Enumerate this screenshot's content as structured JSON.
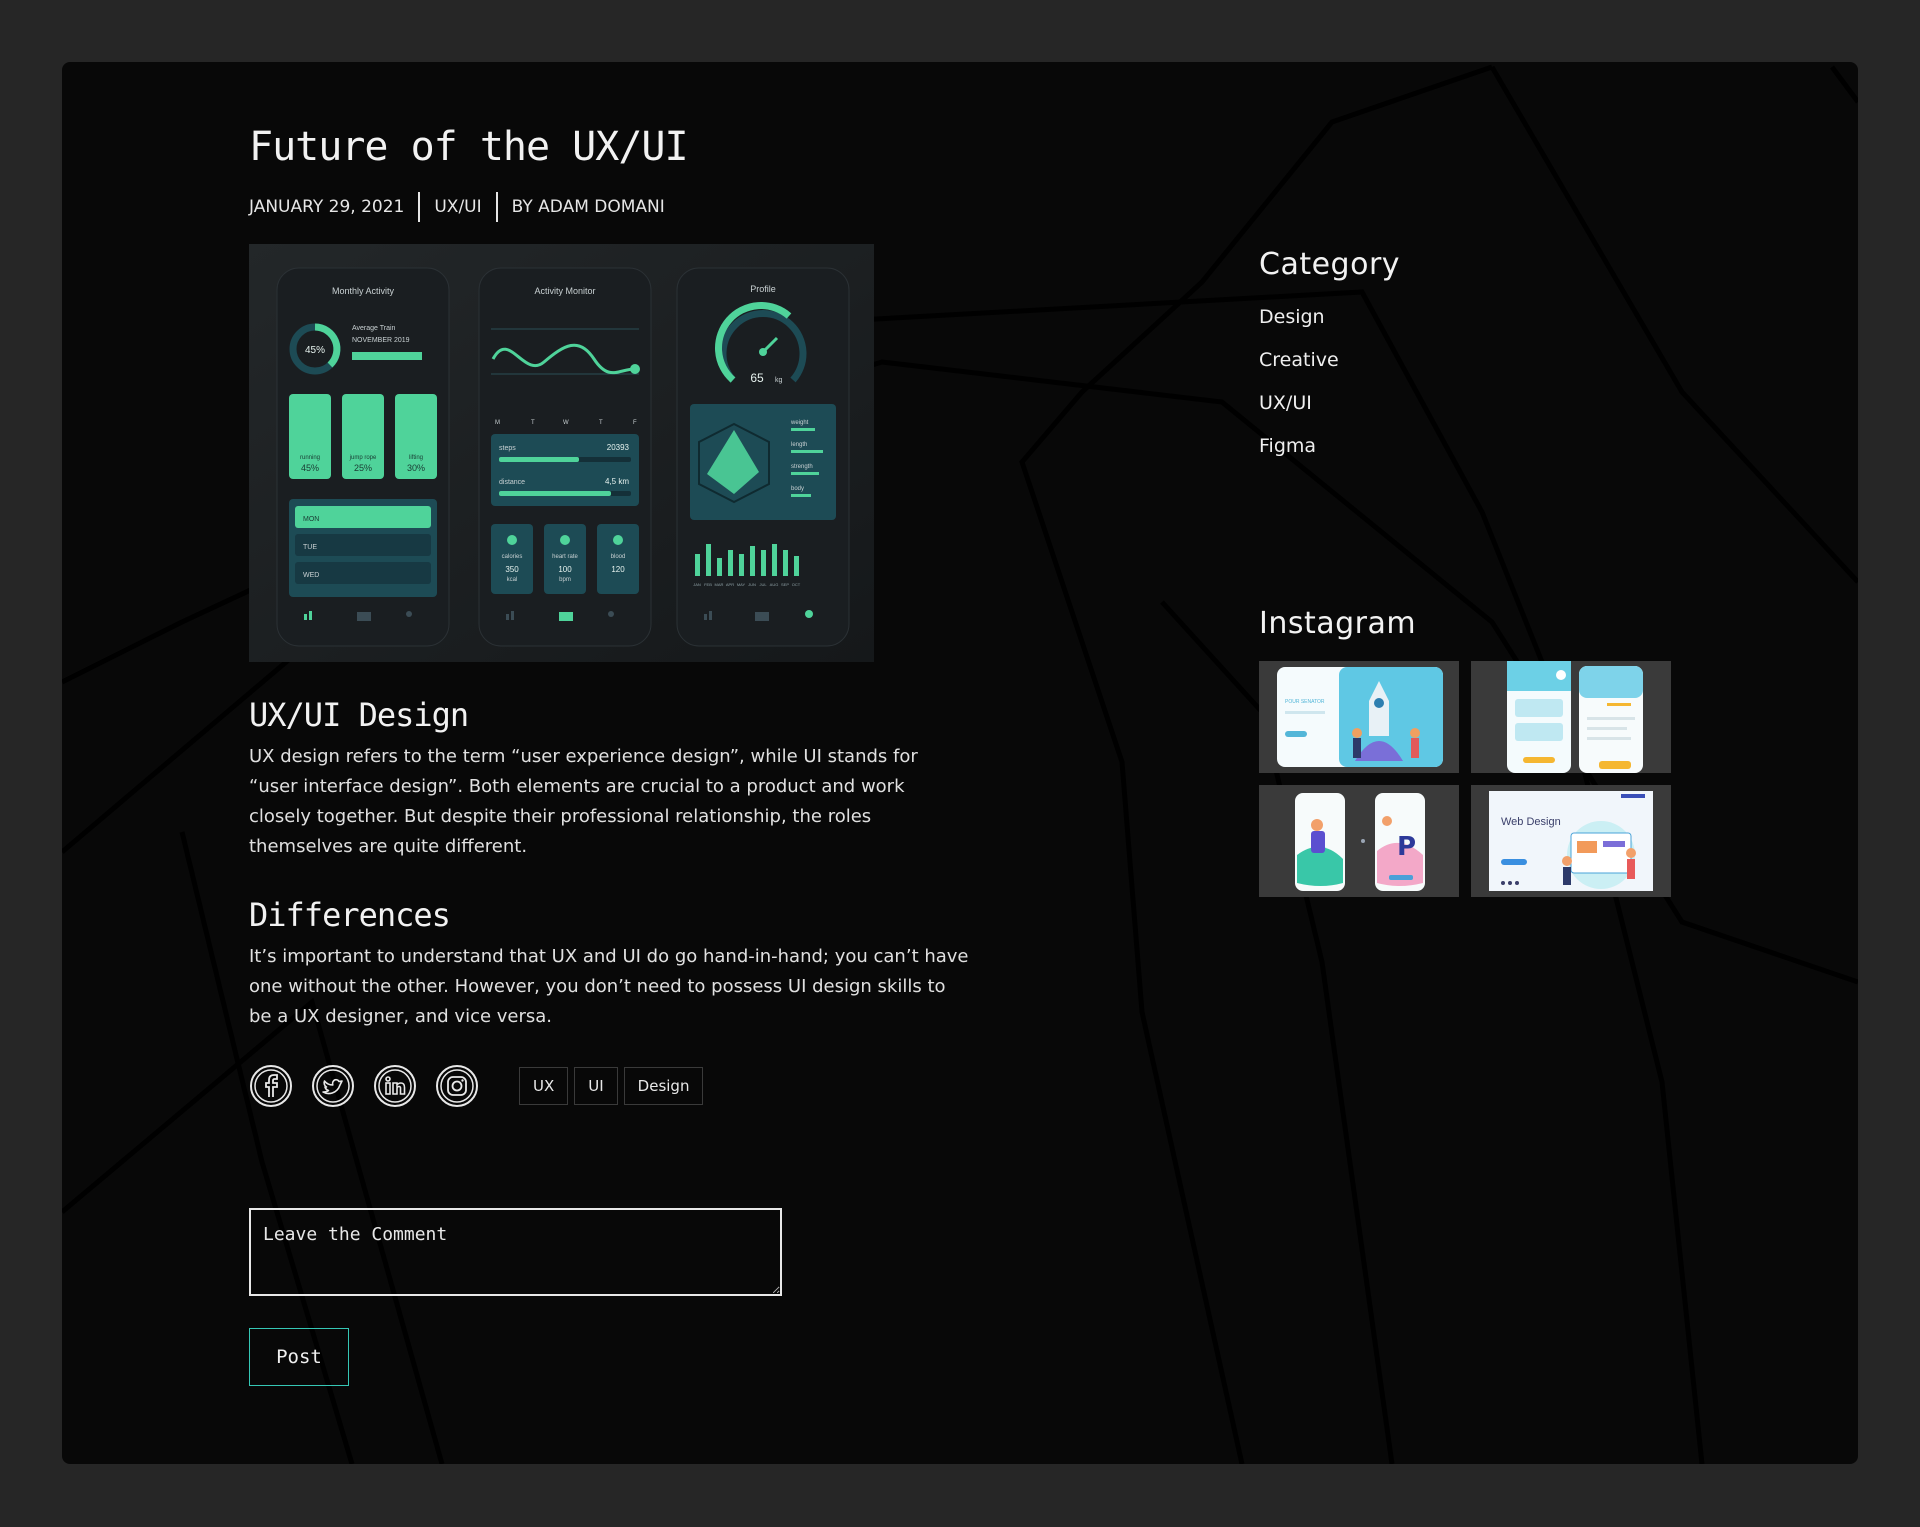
{
  "post": {
    "title": "Future of the UX/UI",
    "date": "JANUARY 29, 2021",
    "category": "UX/UI",
    "author": "BY ADAM DOMANI",
    "hero_image": {
      "screens": [
        {
          "title": "Monthly Activity",
          "ring_value": "45%",
          "subtitle_1": "Average Train",
          "subtitle_2": "NOVEMBER 2019",
          "tiles": [
            {
              "label": "running",
              "value": "45%"
            },
            {
              "label": "jump rope",
              "value": "25%"
            },
            {
              "label": "lifting",
              "value": "30%"
            }
          ],
          "days": [
            "MON",
            "TUE",
            "WED"
          ]
        },
        {
          "title": "Activity Monitor",
          "days": [
            "M",
            "T",
            "W",
            "T",
            "F"
          ],
          "steps_label": "steps",
          "steps_value": "20393",
          "distance_label": "distance",
          "distance_value": "4,5 km",
          "stats": [
            {
              "label": "calories",
              "value": "350",
              "unit": "kcal"
            },
            {
              "label": "heart rate",
              "value": "100",
              "unit": "bpm"
            },
            {
              "label": "blood",
              "value": "120",
              "unit": ""
            }
          ]
        },
        {
          "title": "Profile",
          "gauge_value": "65",
          "gauge_unit": "kg",
          "metrics": [
            "weight",
            "length",
            "strength",
            "body"
          ],
          "months": [
            "JAN",
            "FEB",
            "MAR",
            "APR",
            "MAY",
            "JUN",
            "JUL",
            "AUG",
            "SEP",
            "OCT"
          ]
        }
      ]
    },
    "section1": {
      "heading": "UX/UI Design",
      "text": "UX design refers to the term “user experience design”, while UI stands for “user interface design”. Both elements are crucial to a product and work closely together. But despite their professional relationship, the roles themselves are quite different."
    },
    "section2": {
      "heading": "Differences",
      "text": "It’s important to understand that UX and UI do go hand-in-hand; you can’t have one without the other. However, you don’t need to possess UI design skills to be a UX designer, and vice versa."
    },
    "social_icons": [
      "facebook-icon",
      "twitter-icon",
      "linkedin-icon",
      "instagram-icon"
    ],
    "tags": [
      "UX",
      "UI",
      "Design"
    ]
  },
  "comment": {
    "placeholder": "Leave the Comment",
    "post_label": "Post"
  },
  "sidebar": {
    "category_title": "Category",
    "categories": [
      "Design",
      "Creative",
      "UX/UI",
      "Figma"
    ],
    "instagram_title": "Instagram",
    "instagram_tiles": [
      {
        "text": "POUR SENATOR"
      },
      {
        "text": ""
      },
      {
        "text": ""
      },
      {
        "text": "Web Design"
      }
    ]
  },
  "colors": {
    "page_bg": "#262626",
    "frame_bg": "#080808",
    "accent": "#35c7b5",
    "app_green": "#4fd39a",
    "app_teal": "#1d4b55"
  }
}
